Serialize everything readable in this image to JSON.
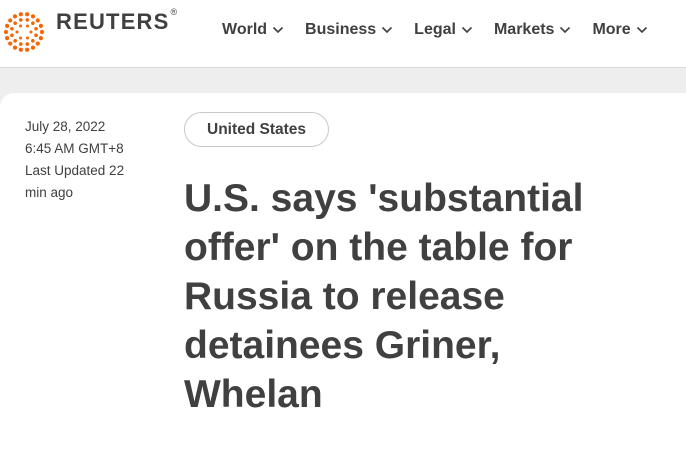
{
  "header": {
    "logo_text": "REUTERS",
    "logo_mark": "®",
    "brand_color": "#fa6400",
    "nav": [
      {
        "label": "World",
        "icon": "chevron-down-icon"
      },
      {
        "label": "Business",
        "icon": "chevron-down-icon"
      },
      {
        "label": "Legal",
        "icon": "chevron-down-icon"
      },
      {
        "label": "Markets",
        "icon": "chevron-down-icon"
      },
      {
        "label": "More",
        "icon": "chevron-down-icon"
      }
    ]
  },
  "article": {
    "date": "July 28, 2022",
    "time": "6:45 AM GMT+8",
    "updated_line1": "Last Updated 22",
    "updated_line2": "min ago",
    "tag": "United States",
    "headline_lines": [
      "U.S. says 'substantial",
      "offer' on the table for",
      "Russia to release",
      "detainees Griner,",
      "Whelan"
    ]
  }
}
